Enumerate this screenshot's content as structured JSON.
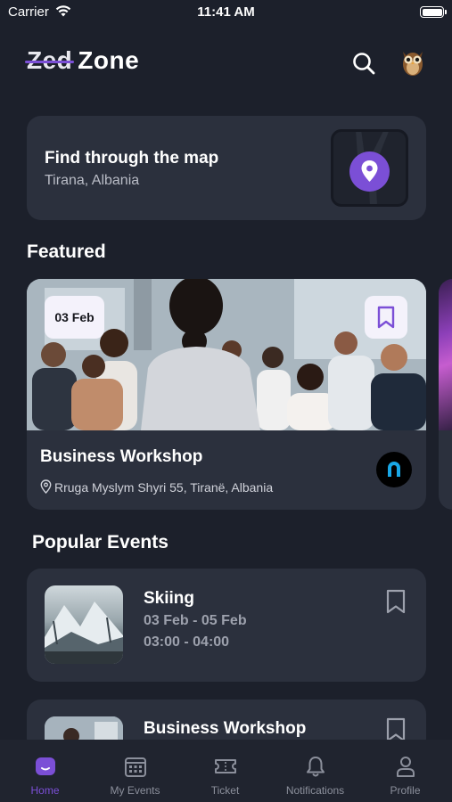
{
  "status_bar": {
    "carrier": "Carrier",
    "time": "11:41 AM"
  },
  "header": {
    "logo_strike": "Zed",
    "logo_text": "Zone",
    "accent_color": "#7b4fd6"
  },
  "map_card": {
    "title": "Find through the map",
    "subtitle": "Tirana, Albania",
    "icon": "location-pin-icon"
  },
  "featured": {
    "section_title": "Featured",
    "cards": [
      {
        "date": "03 Feb",
        "title": "Business Workshop",
        "location": "Rruga Myslym Shyri 55, Tiranë, Albania",
        "bookmark_icon": "bookmark-icon"
      }
    ]
  },
  "popular": {
    "section_title": "Popular Events",
    "events": [
      {
        "name": "Skiing",
        "dates": "03 Feb  - 05 Feb",
        "times": "03:00 - 04:00"
      },
      {
        "name": "Business Workshop"
      }
    ]
  },
  "tab_bar": {
    "tabs": [
      {
        "label": "Home",
        "icon": "home-icon",
        "active": true
      },
      {
        "label": "My Events",
        "icon": "calendar-icon",
        "active": false
      },
      {
        "label": "Ticket",
        "icon": "ticket-icon",
        "active": false
      },
      {
        "label": "Notifications",
        "icon": "bell-icon",
        "active": false
      },
      {
        "label": "Profile",
        "icon": "user-icon",
        "active": false
      }
    ],
    "active_color": "#7b4fd6",
    "inactive_color": "#8b8f9b"
  }
}
